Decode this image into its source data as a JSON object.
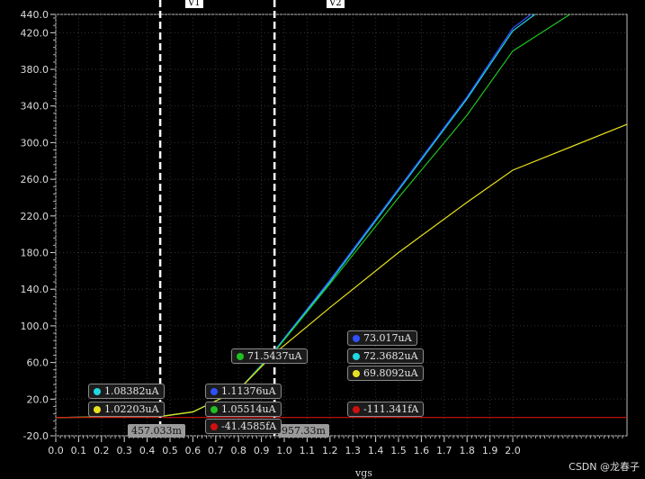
{
  "chart_data": {
    "type": "line",
    "xlabel": "vgs",
    "ylabel": "",
    "xlim": [
      0.0,
      2.5
    ],
    "ylim": [
      -20.0,
      440.0
    ],
    "x_ticks": [
      "0.0",
      "0.1",
      "0.2",
      "0.3",
      "0.4",
      "0.5",
      "0.6",
      "0.7",
      "0.8",
      "0.9",
      "1.0",
      "1.1",
      "1.2",
      "1.3",
      "1.4",
      "1.5",
      "1.6",
      "1.7",
      "1.8",
      "1.9",
      "2.0"
    ],
    "y_ticks": [
      "-20.0",
      "20.0",
      "60.0",
      "100.0",
      "140.0",
      "180.0",
      "220.0",
      "260.0",
      "300.0",
      "340.0",
      "380.0",
      "420.0",
      "440.0"
    ],
    "grid": true,
    "series": [
      {
        "color": "#3050ff",
        "x": [
          0,
          0.457,
          0.6,
          0.8,
          0.957,
          1.2,
          1.5,
          1.8,
          2.0,
          2.5
        ],
        "y": [
          0,
          1.11376,
          6,
          30,
          73.017,
          150,
          250,
          350,
          425,
          520
        ]
      },
      {
        "color": "#20d8e0",
        "x": [
          0,
          0.457,
          0.6,
          0.8,
          0.957,
          1.2,
          1.5,
          1.8,
          2.0,
          2.5
        ],
        "y": [
          0,
          1.08382,
          6,
          30,
          72.3682,
          148,
          248,
          348,
          422,
          515
        ]
      },
      {
        "color": "#20c020",
        "x": [
          0,
          0.457,
          0.6,
          0.8,
          0.957,
          1.2,
          1.5,
          1.8,
          2.0,
          2.5
        ],
        "y": [
          0,
          1.05514,
          6,
          30,
          71.5437,
          146,
          240,
          330,
          400,
          480
        ]
      },
      {
        "color": "#e8e020",
        "x": [
          0,
          0.457,
          0.6,
          0.8,
          0.957,
          1.2,
          1.5,
          1.8,
          2.0,
          2.5
        ],
        "y": [
          0,
          1.02203,
          6,
          30,
          69.8092,
          120,
          180,
          235,
          270,
          320
        ]
      },
      {
        "color": "#d01010",
        "x": [
          0,
          2.5
        ],
        "y": [
          0,
          0
        ]
      }
    ],
    "markers": [
      {
        "name": "V1",
        "x": 0.457033,
        "label": "457.033m"
      },
      {
        "name": "V2",
        "x": 0.95733,
        "label": "957.33m"
      }
    ],
    "annotations": [
      {
        "text": "1.08382uA",
        "color": "#20d8e0"
      },
      {
        "text": "1.02203uA",
        "color": "#e8e020"
      },
      {
        "text": "1.11376uA",
        "color": "#3050ff"
      },
      {
        "text": "1.05514uA",
        "color": "#20c020"
      },
      {
        "text": "-41.4585fA",
        "color": "#d01010"
      },
      {
        "text": "71.5437uA",
        "color": "#20c020"
      },
      {
        "text": "73.017uA",
        "color": "#3050ff"
      },
      {
        "text": "72.3682uA",
        "color": "#20d8e0"
      },
      {
        "text": "69.8092uA",
        "color": "#e8e020"
      },
      {
        "text": "-111.341fA",
        "color": "#d01010"
      }
    ]
  },
  "watermark": "CSDN @龙春子"
}
